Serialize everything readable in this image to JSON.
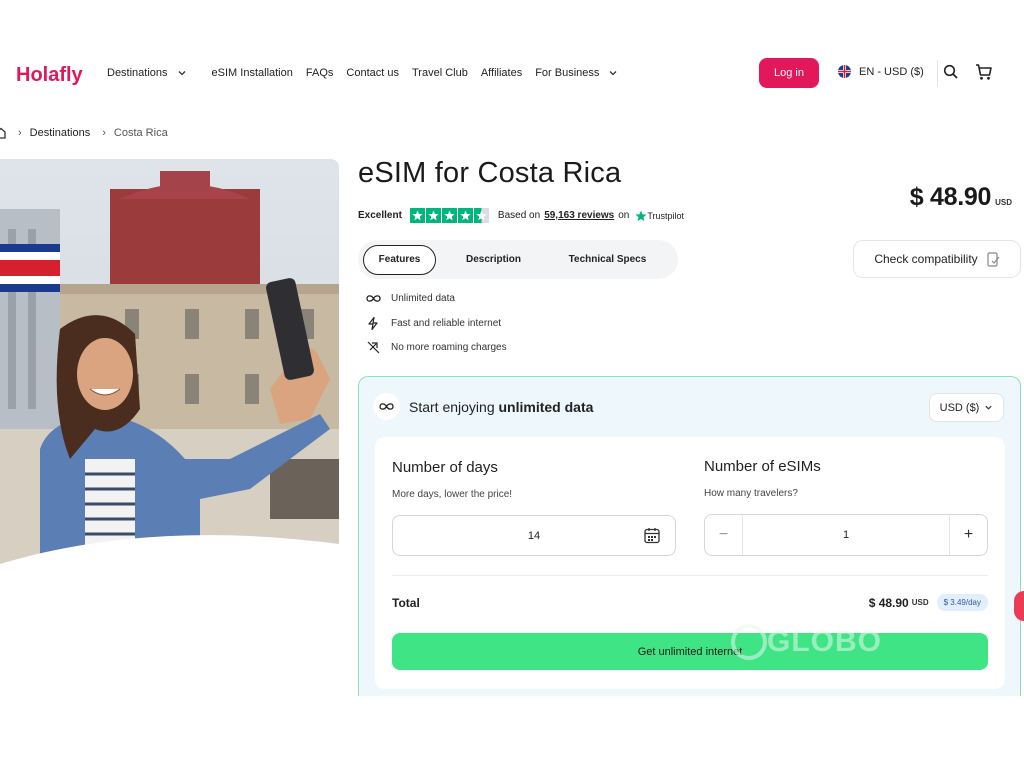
{
  "header": {
    "logo_text": "Holafly",
    "nav": [
      {
        "label": "Destinations",
        "dropdown": true
      },
      {
        "label": "eSIM Installation",
        "dropdown": false
      },
      {
        "label": "FAQs",
        "dropdown": false
      },
      {
        "label": "Contact us",
        "dropdown": false
      },
      {
        "label": "Travel Club",
        "dropdown": false
      },
      {
        "label": "Affiliates",
        "dropdown": false
      },
      {
        "label": "For Business",
        "dropdown": true
      }
    ],
    "login_label": "Log in",
    "language": "EN - USD ($)",
    "brand_color": "#e2185b"
  },
  "breadcrumb": {
    "items": [
      "Destinations",
      "Costa Rica"
    ]
  },
  "product": {
    "title": "eSIM for Costa Rica",
    "price": "$ 48.90",
    "currency": "USD",
    "rating_word": "Excellent",
    "stars": 4.5,
    "based_on": "Based on",
    "reviews": "59,163 reviews",
    "on": "on",
    "trustpilot": "Trustpilot"
  },
  "tabs": [
    {
      "label": "Features",
      "active": true
    },
    {
      "label": "Description",
      "active": false
    },
    {
      "label": "Technical Specs",
      "active": false
    }
  ],
  "check_compat_label": "Check compatibility",
  "features": [
    {
      "icon": "infinity-icon",
      "text": "Unlimited data"
    },
    {
      "icon": "lightning-icon",
      "text": "Fast and reliable internet"
    },
    {
      "icon": "no-roaming-icon",
      "text": "No more roaming charges"
    }
  ],
  "plan": {
    "heading_prefix": "Start enjoying",
    "heading_bold": "unlimited data",
    "currency_select": "USD ($)",
    "days_label": "Number of days",
    "days_hint": "More days, lower the price!",
    "days_value": "14",
    "esims_label": "Number of eSIMs",
    "esims_hint": "How many travelers?",
    "esims_value": "1",
    "minus": "−",
    "plus": "+",
    "total_label": "Total",
    "total_price": "$ 48.90",
    "total_currency": "USD",
    "per_day": "$ 3.49/day",
    "cta_label": "Get unlimited internet",
    "cta_color": "#3fe584",
    "watermark": "GLOBO"
  }
}
